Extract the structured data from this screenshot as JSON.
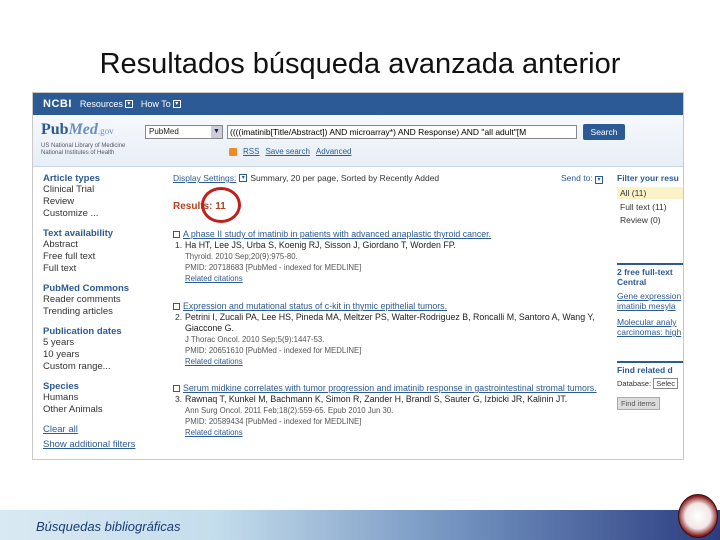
{
  "slide": {
    "title": "Resultados búsqueda avanzada anterior",
    "footer": "Búsquedas bibliográficas"
  },
  "ncbi": {
    "logo": "NCBI",
    "menu": [
      "Resources",
      "How To"
    ]
  },
  "pubmed": {
    "logo_pub": "Pub",
    "logo_med": "Med",
    "logo_gov": ".gov",
    "subtitle": "US National Library of Medicine National Institutes of Health",
    "db_value": "PubMed",
    "query": "((((imatinib[Title/Abstract]) AND microarray*) AND Response) AND \"all adult\"[M",
    "search_label": "Search",
    "links": [
      "RSS",
      "Save search",
      "Advanced"
    ]
  },
  "sidebar": [
    {
      "heading": "Article types",
      "items": [
        "Clinical Trial",
        "Review",
        "Customize ..."
      ]
    },
    {
      "heading": "Text availability",
      "items": [
        "Abstract",
        "Free full text",
        "Full text"
      ]
    },
    {
      "heading": "PubMed Commons",
      "items": [
        "Reader comments",
        "Trending articles"
      ]
    },
    {
      "heading": "Publication dates",
      "items": [
        "5 years",
        "10 years",
        "Custom range..."
      ]
    },
    {
      "heading": "Species",
      "items": [
        "Humans",
        "Other Animals"
      ]
    }
  ],
  "sidebar_links": [
    "Clear all",
    "Show additional filters"
  ],
  "display": {
    "label": "Display Settings:",
    "summary": "Summary, 20 per page, Sorted by Recently Added",
    "send_to": "Send to:",
    "results_label": "Results: 11"
  },
  "citations": [
    {
      "num": "1.",
      "title": "A phase II study of imatinib in patients with advanced anaplastic thyroid cancer.",
      "authors": "Ha HT, Lee JS, Urba S, Koenig RJ, Sisson J, Giordano T, Worden FP.",
      "journal": "Thyroid. 2010 Sep;20(9):975-80.",
      "pmid": "PMID: 20718683 [PubMed - indexed for MEDLINE]",
      "related": "Related citations"
    },
    {
      "num": "2.",
      "title": "Expression and mutational status of c-kit in thymic epithelial tumors.",
      "authors": "Petrini I, Zucali PA, Lee HS, Pineda MA, Meltzer PS, Walter-Rodriguez B, Roncalli M, Santoro A, Wang Y, Giaccone G.",
      "journal": "J Thorac Oncol. 2010 Sep;5(9):1447-53.",
      "pmid": "PMID: 20651610 [PubMed - indexed for MEDLINE]",
      "related": "Related citations"
    },
    {
      "num": "3.",
      "title": "Serum midkine correlates with tumor progression and imatinib response in gastrointestinal stromal tumors.",
      "authors": "Rawnaq T, Kunkel M, Bachmann K, Simon R, Zander H, Brandl S, Sauter G, Izbicki JR, Kalinin JT.",
      "journal": "Ann Surg Oncol. 2011 Feb;18(2):559-65. Epub 2010 Jun 30.",
      "pmid": "PMID: 20589434 [PubMed - indexed for MEDLINE]",
      "related": "Related citations"
    }
  ],
  "right": {
    "filter_heading": "Filter your resu",
    "filters": [
      "All (11)",
      "Full text (11)",
      "Review (0)"
    ],
    "free_heading": "2 free full-text",
    "free_heading2": "Central",
    "free_links": [
      "Gene expression",
      "imatinib mesyla",
      "Molecular analy",
      "carcinomas: high"
    ],
    "related_heading": "Find related d",
    "db_label": "Database:",
    "db_select": "Selec",
    "find_items": "Find items"
  }
}
